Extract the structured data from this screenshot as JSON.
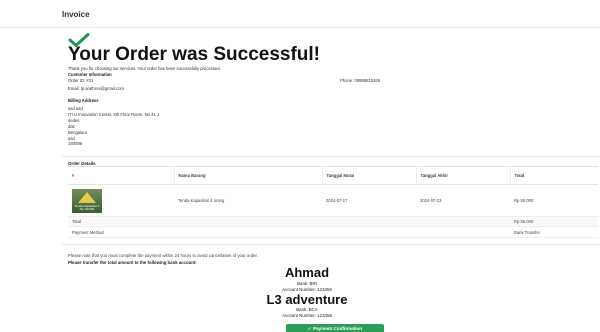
{
  "header": {
    "title": "Invoice"
  },
  "success": {
    "heading": "Your Order was Successful!",
    "thanks": "Thank you for choosing our services. Your order has been successfully processed."
  },
  "customer": {
    "section_title": "Customer Information",
    "order_id": "Order ID: #21",
    "phone": "Phone: 08888815265",
    "email": "Email: lp.arathros@gmail.com"
  },
  "billing": {
    "title": "Billing Address",
    "lines": [
      "asd asd",
      "ITI U Innovation Center, 4th Floor Room, No 41 J",
      "dedes",
      "das",
      "Bengaluru",
      "asd",
      "160089"
    ]
  },
  "order_details": {
    "title": "Order Details",
    "columns": [
      "#",
      "Nama Barang",
      "Tanggal Mulai",
      "Tanggal Akhir",
      "Total"
    ],
    "item": {
      "image_caption_1": "Tenda Kapasitas 4",
      "image_caption_2": "Rp. 50.000",
      "name": "Tenda Kapasitas 4 orang",
      "start": "2024-07-17",
      "end": "2024-07-23",
      "total": "Rp 50.000"
    },
    "total_label": "Total",
    "total_value": "Rp 50.000",
    "payment_label": "Payment Method",
    "payment_value": "Bank Transfer"
  },
  "instructions": {
    "line1": "Please note that you must complete the payment within 24 hours to avoid cancellation of your order.",
    "line2": "Please transfer the total amount to the following bank account:"
  },
  "bank": {
    "name_owner": "Ahmad",
    "bank_line": "Bank: BRI",
    "account_line_1": "Account Number: 123456",
    "name_company": "L3 adventure",
    "bank_line_2": "Bank: BCA",
    "account_line_2": "Account Number: 123456"
  },
  "confirm_button": {
    "label": "Payment Confirmation"
  },
  "colors": {
    "accent": "#2e9c5a",
    "check": "#1e9a4c"
  }
}
